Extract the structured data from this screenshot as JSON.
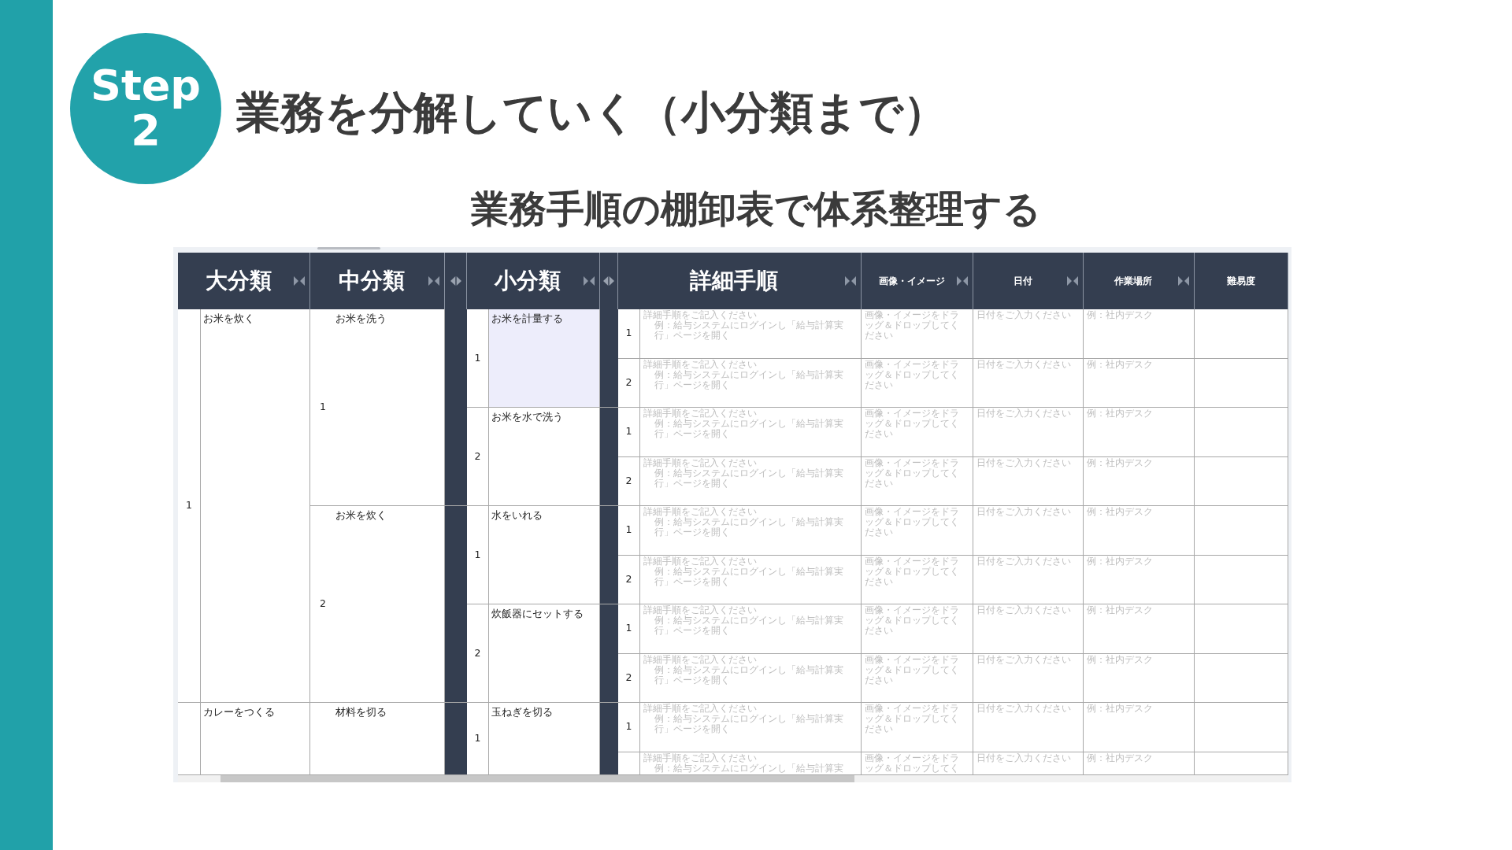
{
  "slide": {
    "step_label": "Step",
    "step_number": "2",
    "title": "業務を分解していく（小分類まで）",
    "subtitle": "業務手順の棚卸表で体系整理する"
  },
  "table": {
    "headers": [
      {
        "kind": "title",
        "label": "大分類",
        "collapse": true
      },
      {
        "kind": "title",
        "label": "中分類",
        "collapse": true
      },
      {
        "kind": "toggle"
      },
      {
        "kind": "title",
        "label": "小分類",
        "collapse": true
      },
      {
        "kind": "toggle"
      },
      {
        "kind": "title",
        "label": "詳細手順",
        "collapse": true
      },
      {
        "kind": "subtitle",
        "label": "画像・イメージ",
        "collapse": true
      },
      {
        "kind": "subtitle",
        "label": "日付",
        "collapse": true
      },
      {
        "kind": "subtitle",
        "label": "作業場所",
        "collapse": true
      },
      {
        "kind": "subtitle",
        "label": "難易度",
        "collapse": false
      }
    ],
    "categories": [
      {
        "number": "1",
        "name": "お米を炊く",
        "middle": [
          {
            "number": "1",
            "name": "お米を洗う",
            "small": [
              {
                "number": "1",
                "name": "お米を計量する",
                "selected": true,
                "steps": [
                  {
                    "number": "1",
                    "detail": "詳細手順をご記入ください",
                    "example": "例：給与システムにログインし「給与計算実行」ページを開く",
                    "image": "画像・イメージをドラッグ＆ドロップしてください",
                    "date": "日付をご入力ください",
                    "place": "例：社内デスク"
                  },
                  {
                    "number": "2",
                    "detail": "詳細手順をご記入ください",
                    "example": "例：給与システムにログインし「給与計算実行」ページを開く",
                    "image": "画像・イメージをドラッグ＆ドロップしてください",
                    "date": "日付をご入力ください",
                    "place": "例：社内デスク"
                  }
                ]
              },
              {
                "number": "2",
                "name": "お米を水で洗う",
                "selected": false,
                "steps": [
                  {
                    "number": "1",
                    "detail": "詳細手順をご記入ください",
                    "example": "例：給与システムにログインし「給与計算実行」ページを開く",
                    "image": "画像・イメージをドラッグ＆ドロップしてください",
                    "date": "日付をご入力ください",
                    "place": "例：社内デスク"
                  },
                  {
                    "number": "2",
                    "detail": "詳細手順をご記入ください",
                    "example": "例：給与システムにログインし「給与計算実行」ページを開く",
                    "image": "画像・イメージをドラッグ＆ドロップしてください",
                    "date": "日付をご入力ください",
                    "place": "例：社内デスク"
                  }
                ]
              }
            ]
          },
          {
            "number": "2",
            "name": "お米を炊く",
            "small": [
              {
                "number": "1",
                "name": "水をいれる",
                "selected": false,
                "steps": [
                  {
                    "number": "1",
                    "detail": "詳細手順をご記入ください",
                    "example": "例：給与システムにログインし「給与計算実行」ページを開く",
                    "image": "画像・イメージをドラッグ＆ドロップしてください",
                    "date": "日付をご入力ください",
                    "place": "例：社内デスク"
                  },
                  {
                    "number": "2",
                    "detail": "詳細手順をご記入ください",
                    "example": "例：給与システムにログインし「給与計算実行」ページを開く",
                    "image": "画像・イメージをドラッグ＆ドロップしてください",
                    "date": "日付をご入力ください",
                    "place": "例：社内デスク"
                  }
                ]
              },
              {
                "number": "2",
                "name": "炊飯器にセットする",
                "selected": false,
                "steps": [
                  {
                    "number": "1",
                    "detail": "詳細手順をご記入ください",
                    "example": "例：給与システムにログインし「給与計算実行」ページを開く",
                    "image": "画像・イメージをドラッグ＆ドロップしてください",
                    "date": "日付をご入力ください",
                    "place": "例：社内デスク"
                  },
                  {
                    "number": "2",
                    "detail": "詳細手順をご記入ください",
                    "example": "例：給与システムにログインし「給与計算実行」ページを開く",
                    "image": "画像・イメージをドラッグ＆ドロップしてください",
                    "date": "日付をご入力ください",
                    "place": "例：社内デスク"
                  }
                ]
              }
            ]
          }
        ]
      },
      {
        "name": "カレーをつくる",
        "middle": [
          {
            "name": "材料を切る",
            "small": [
              {
                "number": "1",
                "name": "玉ねぎを切る",
                "selected": false,
                "steps": [
                  {
                    "number": "1",
                    "detail": "詳細手順をご記入ください",
                    "example": "例：給与システムにログインし「給与計算実行」ページを開く",
                    "image": "画像・イメージをドラッグ＆ドロップしてください",
                    "date": "日付をご入力ください",
                    "place": "例：社内デスク"
                  },
                  {
                    "detail": "詳細手順をご記入ください",
                    "example": "例：給与システムにログインし「給与計算実",
                    "image": "画像・イメージをドラッグ＆ドロップしてく",
                    "date": "日付をご入力ください",
                    "place": "例：社内デスク"
                  }
                ]
              }
            ]
          }
        ]
      }
    ]
  }
}
